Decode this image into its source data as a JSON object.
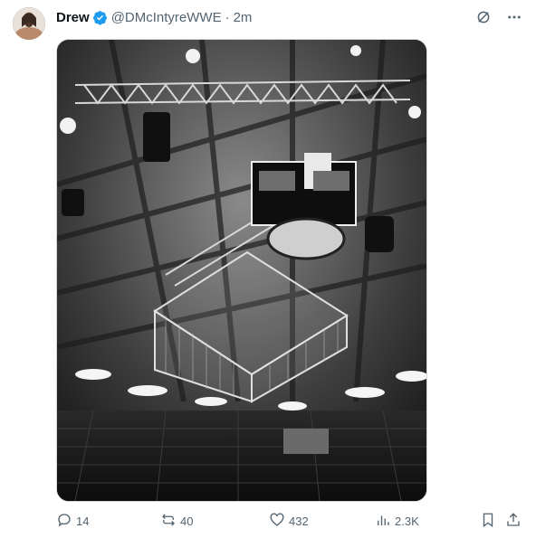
{
  "tweet": {
    "author_name": "Drew",
    "handle": "@DMcIntyreWWE",
    "separator": "·",
    "timestamp": "2m"
  },
  "metrics": {
    "replies": "14",
    "reposts": "40",
    "likes": "432",
    "views": "2.3K"
  },
  "colors": {
    "verified_badge": "#1d9bf0",
    "muted_text": "#536471",
    "border": "#cfd9de"
  },
  "icons": [
    "avatar",
    "verified-badge-icon",
    "grok-icon",
    "more-icon",
    "reply-icon",
    "repost-icon",
    "like-icon",
    "views-icon",
    "bookmark-icon",
    "share-icon"
  ]
}
